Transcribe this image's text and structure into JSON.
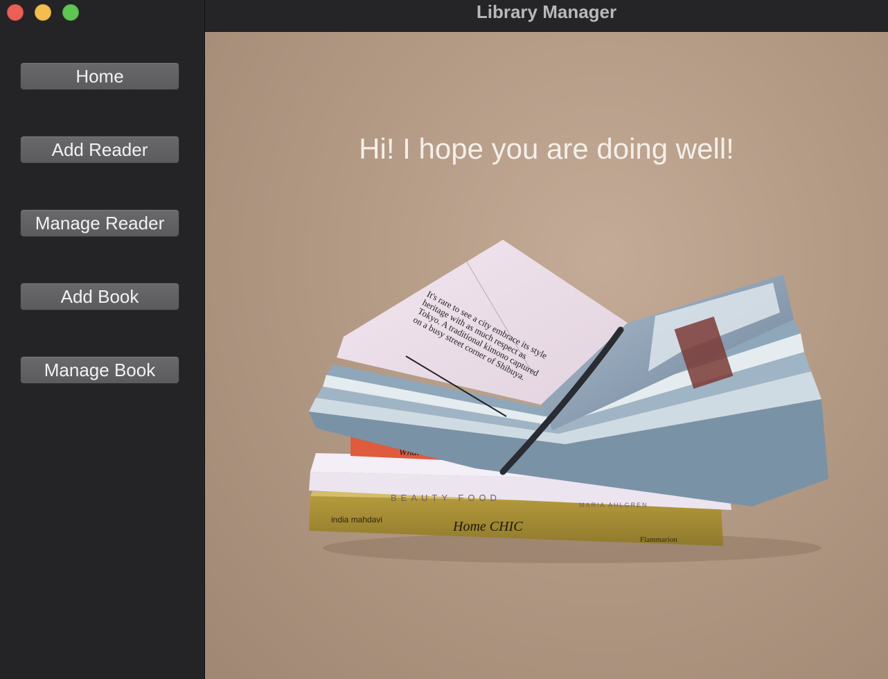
{
  "window": {
    "title": "Library Manager"
  },
  "sidebar": {
    "items": [
      {
        "label": "Home"
      },
      {
        "label": "Add Reader"
      },
      {
        "label": "Manage Reader"
      },
      {
        "label": "Add Book"
      },
      {
        "label": "Manage Book"
      }
    ]
  },
  "main": {
    "greeting": "Hi! I hope you are doing well!",
    "image": {
      "book_texts": {
        "page_quote": "It's rare to see a city embrace its style heritage with as much respect as Tokyo. A traditional kimono captured on a busy street corner of Shibuya.",
        "spine_red": "What on earth",
        "spine_white": "BEAUTY FOOD",
        "spine_white_author": "MARIA AHLGREN",
        "spine_gold": "Home CHIC",
        "spine_gold_author": "india mahdavi",
        "spine_gold_publisher": "Flammarion"
      }
    }
  },
  "colors": {
    "traffic_red": "#ec5f57",
    "traffic_yellow": "#f4bd4f",
    "traffic_green": "#5fc553",
    "sidebar_bg": "#242426",
    "button_bg": "#636365",
    "content_bg": "#b39a85"
  }
}
